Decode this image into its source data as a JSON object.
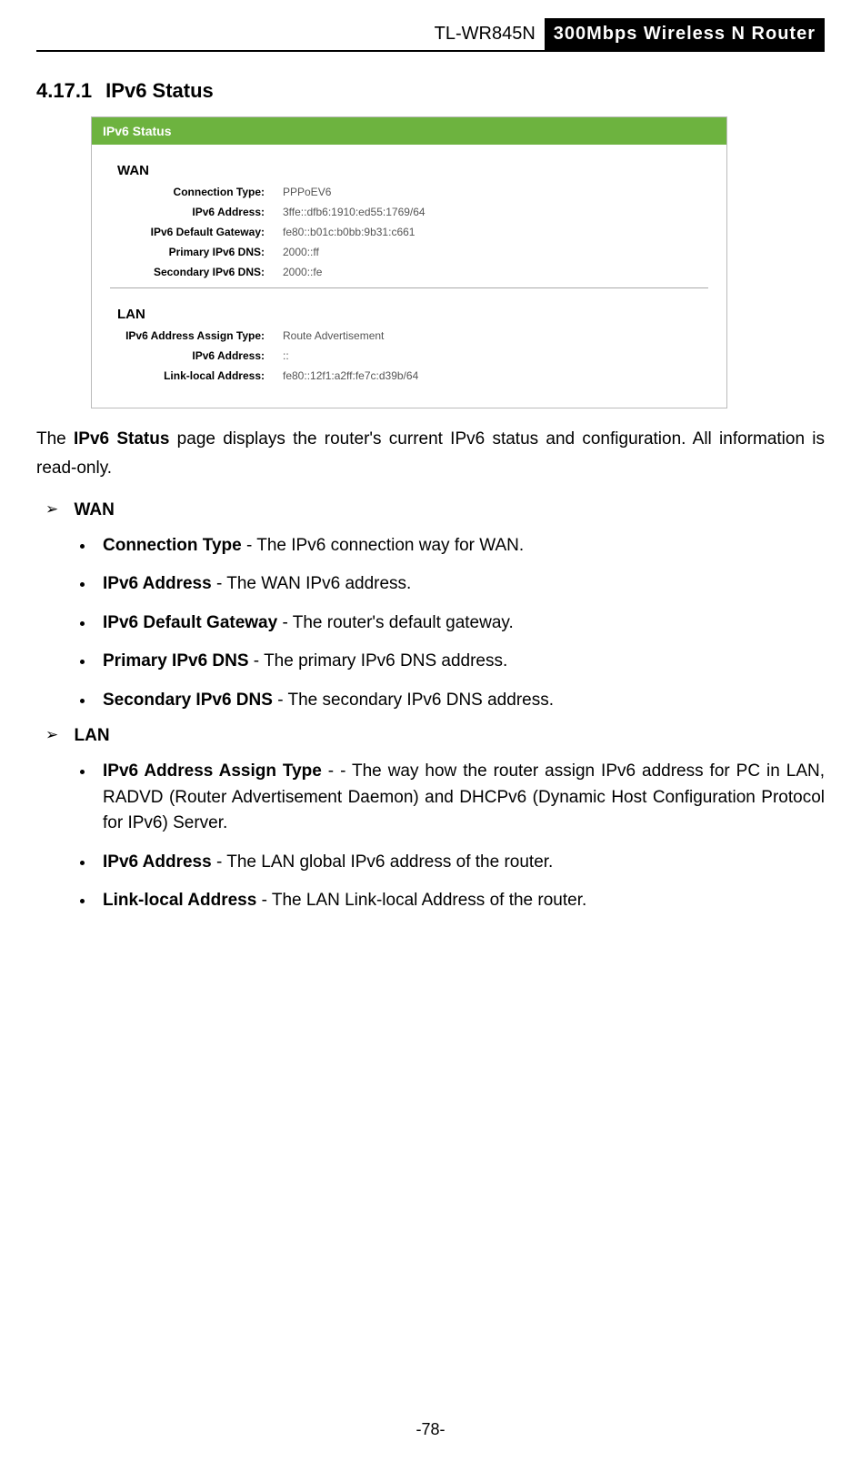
{
  "header": {
    "model": "TL-WR845N",
    "product": "300Mbps Wireless N Router"
  },
  "section": {
    "number": "4.17.1",
    "title": "IPv6 Status"
  },
  "panel": {
    "title": "IPv6 Status",
    "wan": {
      "heading": "WAN",
      "rows": {
        "conn_type_label": "Connection Type:",
        "conn_type_value": "PPPoEV6",
        "addr_label": "IPv6 Address:",
        "addr_value": "3ffe::dfb6:1910:ed55:1769/64",
        "gw_label": "IPv6 Default Gateway:",
        "gw_value": "fe80::b01c:b0bb:9b31:c661",
        "pdns_label": "Primary IPv6 DNS:",
        "pdns_value": "2000::ff",
        "sdns_label": "Secondary IPv6 DNS:",
        "sdns_value": "2000::fe"
      }
    },
    "lan": {
      "heading": "LAN",
      "rows": {
        "assign_label": "IPv6 Address Assign Type:",
        "assign_value": "Route Advertisement",
        "addr_label": "IPv6 Address:",
        "addr_value": "::",
        "ll_label": "Link-local Address:",
        "ll_value": "fe80::12f1:a2ff:fe7c:d39b/64"
      }
    }
  },
  "intro": {
    "pre": "The ",
    "bold": "IPv6 Status",
    "post": " page displays the router's current IPv6 status and configuration. All information is read-only."
  },
  "desc": {
    "wan_heading": "WAN",
    "wan_items": {
      "conn_b": "Connection Type",
      "conn_t": " - The IPv6 connection way for WAN.",
      "addr_b": "IPv6 Address",
      "addr_t": " - The WAN IPv6 address.",
      "gw_b": "IPv6 Default Gateway",
      "gw_t": " - The router's default gateway.",
      "pdns_b": "Primary IPv6 DNS",
      "pdns_t": " - The primary IPv6 DNS address.",
      "sdns_b": "Secondary IPv6 DNS",
      "sdns_t": " - The secondary IPv6 DNS address."
    },
    "lan_heading": "LAN",
    "lan_items": {
      "assign_b": "IPv6 Address Assign Type",
      "assign_t": " - - The way how the router assign IPv6 address for PC in LAN, RADVD (Router Advertisement Daemon) and DHCPv6 (Dynamic Host Configuration Protocol for IPv6) Server.",
      "addr_b": "IPv6 Address",
      "addr_t": " - The LAN global IPv6 address of the router.",
      "ll_b": "Link-local Address",
      "ll_t": " - The LAN Link-local Address of the router."
    }
  },
  "page_number": "-78-"
}
